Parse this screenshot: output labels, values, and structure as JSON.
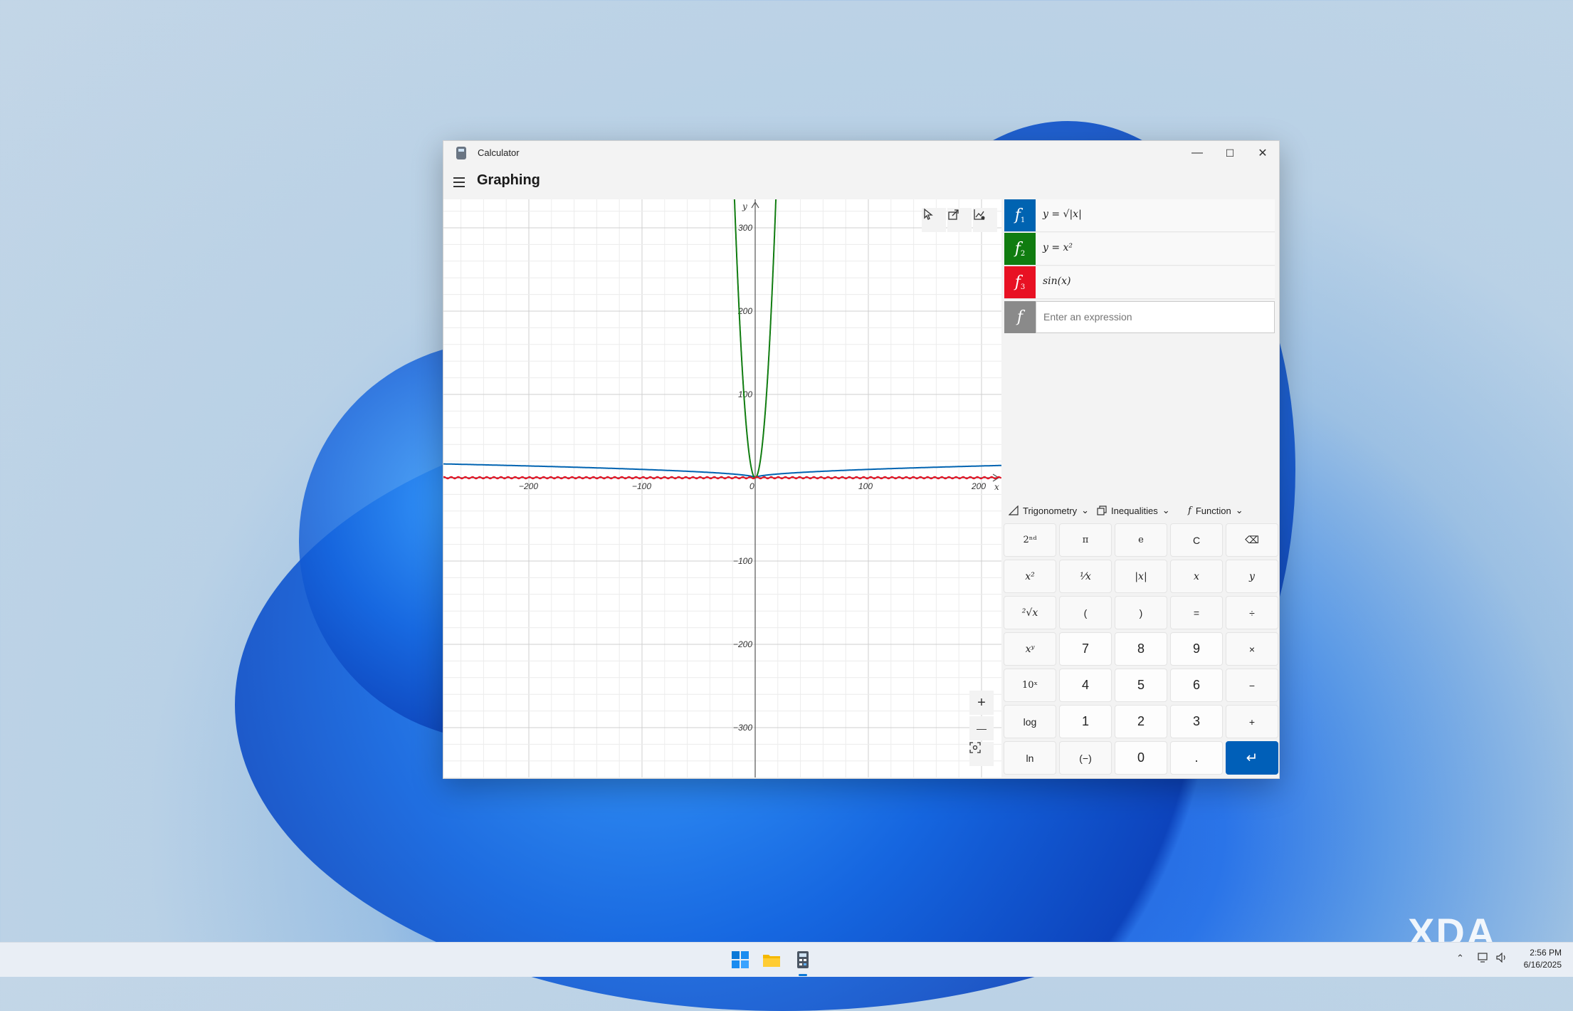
{
  "window": {
    "app_title": "Calculator",
    "minimize": "—",
    "maximize": "☐",
    "close": "✕"
  },
  "header": {
    "mode_title": "Graphing"
  },
  "graph": {
    "x_axis_label": "x",
    "y_axis_label": "y",
    "x_ticks": [
      "−200",
      "−100",
      "0",
      "100",
      "200"
    ],
    "y_ticks": [
      "300",
      "200",
      "100",
      "−100",
      "−200",
      "−300"
    ],
    "zoom_in": "+",
    "zoom_out": "—"
  },
  "functions": [
    {
      "badge": "f",
      "index": "1",
      "expr": "y = √|x|",
      "color": "#0063b1"
    },
    {
      "badge": "f",
      "index": "2",
      "expr": "y = x²",
      "color": "#107c10"
    },
    {
      "badge": "f",
      "index": "3",
      "expr": "sin(x)",
      "color": "#e81123"
    }
  ],
  "new_function": {
    "badge": "f",
    "placeholder": "Enter an expression",
    "color": "#8a8a8a"
  },
  "dropdowns": {
    "trig": "Trigonometry",
    "ineq": "Inequalities",
    "func": "Function"
  },
  "keypad": [
    [
      "2ⁿᵈ",
      "π",
      "e",
      "C",
      "⌫"
    ],
    [
      "x²",
      "¹⁄x",
      "|x|",
      "x",
      "y"
    ],
    [
      "²√x",
      "(",
      ")",
      "=",
      "÷"
    ],
    [
      "xʸ",
      "7",
      "8",
      "9",
      "×"
    ],
    [
      "10ˣ",
      "4",
      "5",
      "6",
      "−"
    ],
    [
      "log",
      "1",
      "2",
      "3",
      "+"
    ],
    [
      "ln",
      "(−)",
      "0",
      ".",
      "↵"
    ]
  ],
  "taskbar": {
    "time": "2:56 PM",
    "date": "6/16/2025"
  },
  "watermark": "XDA"
}
